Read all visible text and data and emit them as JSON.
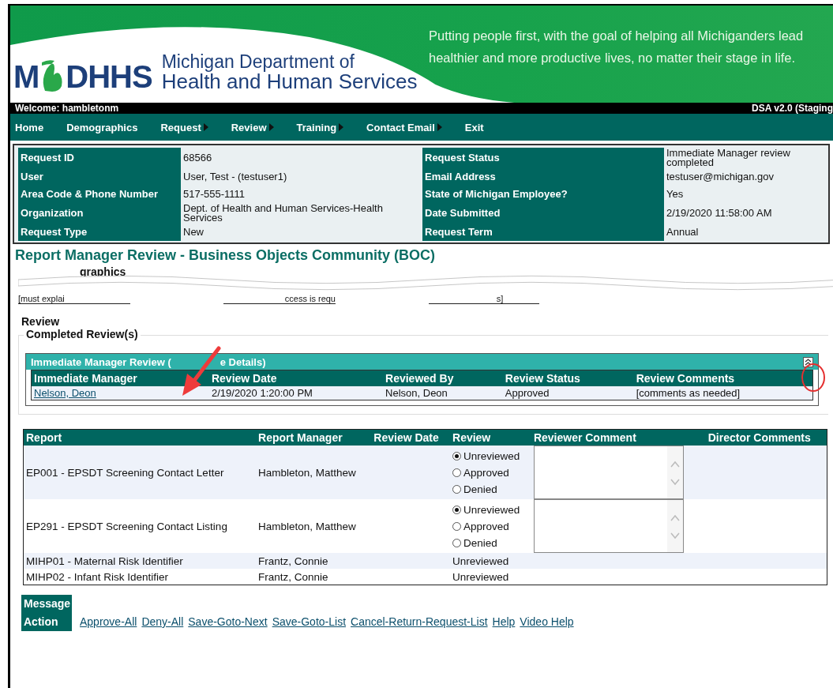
{
  "header": {
    "logo_left": "M",
    "logo_right": "DHHS",
    "dept_line1": "Michigan Department of",
    "dept_line2": "Health and Human Services",
    "tagline": "Putting people first, with the goal of helping all Michiganders lead healthier and more productive lives, no matter their stage in life."
  },
  "welcome": "Welcome: hambletonm",
  "version": "DSA v2.0 (Staging",
  "nav": [
    {
      "label": "Home",
      "has_submenu": false
    },
    {
      "label": "Demographics",
      "has_submenu": false
    },
    {
      "label": "Request",
      "has_submenu": true
    },
    {
      "label": "Review",
      "has_submenu": true
    },
    {
      "label": "Training",
      "has_submenu": true
    },
    {
      "label": "Contact Email",
      "has_submenu": true
    },
    {
      "label": "Exit",
      "has_submenu": false
    }
  ],
  "request_info": [
    {
      "label": "Request ID",
      "value": "68566",
      "label2": "Request Status",
      "value2": "Immediate Manager review completed"
    },
    {
      "label": "User",
      "value": "User, Test - (testuser1)",
      "label2": "Email Address",
      "value2": "testuser@michigan.gov"
    },
    {
      "label": "Area Code & Phone Number",
      "value": "517-555-1111",
      "label2": "State of Michigan Employee?",
      "value2": "Yes"
    },
    {
      "label": "Organization",
      "value": "Dept. of Health and Human Services-Health Services",
      "label2": "Date Submitted",
      "value2": "2/19/2020 11:58:00 AM"
    },
    {
      "label": "Request Type",
      "value": "New",
      "label2": "Request Term",
      "value2": "Annual"
    }
  ],
  "page_title": "Report Manager Review - Business Objects Community (BOC)",
  "torn_section": {
    "heading_fragment": "graphics",
    "fragments": [
      "[must explai",
      "ccess is requ",
      "s]"
    ]
  },
  "review": {
    "heading": "Review",
    "completed_heading": "Completed Review(s)",
    "panel": {
      "title_start": "Immediate Manager Review (",
      "title_end": "e Details)",
      "expanded": true,
      "columns": [
        "Immediate Manager",
        "Review Date",
        "Reviewed By",
        "Review Status",
        "Review Comments"
      ],
      "rows": [
        [
          "Nelson, Deon",
          "2/19/2020 1:20:00 PM",
          "Nelson, Deon",
          "Approved",
          "[comments as needed]"
        ]
      ]
    }
  },
  "reports": {
    "columns": [
      "Report",
      "Report Manager",
      "Review Date",
      "Review",
      "Reviewer Comment",
      "Director Comments"
    ],
    "rows": [
      {
        "kind": "editable",
        "report": "EP001 - EPSDT Screening Contact Letter",
        "manager": "Hambleton, Matthew",
        "options": [
          {
            "label": "Unreviewed",
            "selected": true
          },
          {
            "label": "Approved",
            "selected": false
          },
          {
            "label": "Denied",
            "selected": false
          }
        ]
      },
      {
        "kind": "editable",
        "report": "EP291 - EPSDT Screening Contact Listing",
        "manager": "Hambleton, Matthew",
        "options": [
          {
            "label": "Unreviewed",
            "selected": true
          },
          {
            "label": "Approved",
            "selected": false
          },
          {
            "label": "Denied",
            "selected": false
          }
        ]
      },
      {
        "kind": "readonly",
        "report": "MIHP01 - Maternal Risk Identifier",
        "manager": "Frantz, Connie",
        "status": "Unreviewed"
      },
      {
        "kind": "readonly",
        "report": "MIHP02 - Infant Risk Identifier",
        "manager": "Frantz, Connie",
        "status": "Unreviewed"
      }
    ]
  },
  "actions": {
    "labels": [
      "Message",
      "Action"
    ],
    "links": [
      "Approve-All",
      "Deny-All",
      "Save-Goto-Next",
      "Save-Goto-List",
      "Cancel-Return-Request-List",
      "Help",
      "Video Help"
    ]
  }
}
